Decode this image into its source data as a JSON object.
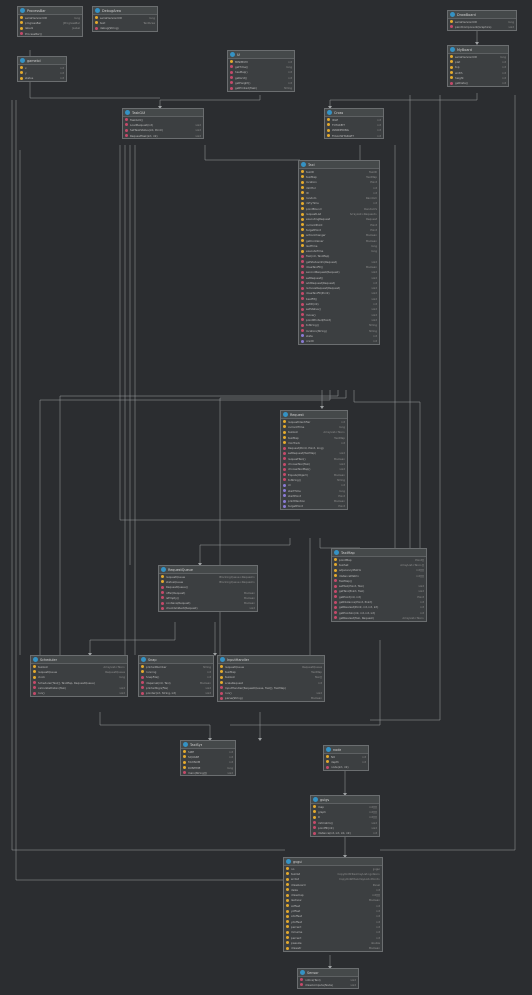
{
  "classes": [
    {
      "id": "processbar",
      "name": "ProcessBar",
      "members": [
        [
          "f",
          "serialVersionUID",
          "long"
        ],
        [
          "f",
          "progressBar",
          "JProgressBar"
        ],
        [
          "f",
          "label1",
          "JLabel"
        ],
        [
          "m",
          "ProcessBar()",
          ""
        ]
      ]
    },
    {
      "id": "debugarea",
      "name": "DebugArea",
      "members": [
        [
          "f",
          "serialVersionUID",
          "long"
        ],
        [
          "f",
          "text",
          "TextArea"
        ],
        [
          "m",
          "debug(String)",
          ""
        ]
      ]
    },
    {
      "id": "drawboard",
      "name": "DrawBoard",
      "members": [
        [
          "f",
          "serialVersionUID",
          "long"
        ],
        [
          "m",
          "paintComponent(Graphics)",
          "void"
        ]
      ]
    },
    {
      "id": "gamelol",
      "name": "gamelol",
      "members": [
        [
          "f",
          "x",
          "int"
        ],
        [
          "f",
          "y",
          "int"
        ],
        [
          "f",
          "status",
          "int"
        ]
      ]
    },
    {
      "id": "ui",
      "name": "UI",
      "members": [
        [
          "f",
          "MINIMUM",
          "int"
        ],
        [
          "m",
          "getTime()",
          "long"
        ],
        [
          "m",
          "hasMap()",
          "int"
        ],
        [
          "m",
          "getGrid()",
          "int"
        ],
        [
          "m",
          "getHeight()",
          "int"
        ],
        [
          "m",
          "getPrinted(Task)",
          "String"
        ]
      ]
    },
    {
      "id": "myboard",
      "name": "MyBoard",
      "members": [
        [
          "f",
          "serialVersionUID",
          "long"
        ],
        [
          "f",
          "plat",
          "int"
        ],
        [
          "f",
          "top",
          "int"
        ],
        [
          "f",
          "width",
          "int"
        ],
        [
          "f",
          "height",
          "int"
        ],
        [
          "m",
          "getData()",
          "int"
        ]
      ]
    },
    {
      "id": "taskgui",
      "name": "TaskGUI",
      "members": [
        [
          "m",
          "TaskGUI()",
          ""
        ],
        [
          "m",
          "LoadRequest(int)",
          "void"
        ],
        [
          "m",
          "SetTaskStatus(int, Point)",
          "void"
        ],
        [
          "m",
          "RequestTask(int, int)",
          "void"
        ]
      ]
    },
    {
      "id": "cross",
      "name": "Cross",
      "members": [
        [
          "f",
          "IDLE",
          "int"
        ],
        [
          "f",
          "TOTAKEIT",
          "int"
        ],
        [
          "f",
          "WANDERING",
          "int"
        ],
        [
          "f",
          "FOLLOWTARGET",
          "int"
        ]
      ]
    },
    {
      "id": "taxi",
      "name": "Taxi",
      "members": [
        [
          "f",
          "taxiID",
          "TaxiID"
        ],
        [
          "f",
          "taxiMap",
          "TaxiMap"
        ],
        [
          "f",
          "location",
          "Point"
        ],
        [
          "f",
          "dimHor",
          "int"
        ],
        [
          "f",
          "ID",
          "int"
        ],
        [
          "f",
          "random",
          "Random"
        ],
        [
          "f",
          "dirtyTime",
          "int"
        ],
        [
          "f",
          "pointBound",
          "RandomS"
        ],
        [
          "f",
          "requestList",
          "ArrayList<Request>"
        ],
        [
          "f",
          "executingRequest",
          "Request"
        ],
        [
          "f",
          "currentPoint",
          "Point"
        ],
        [
          "f",
          "targetPoint",
          "Point"
        ],
        [
          "f",
          "actionChanger",
          "Boolean"
        ],
        [
          "f",
          "getContainer",
          "Boolean"
        ],
        [
          "f",
          "lastTime",
          "long"
        ],
        [
          "f",
          "executeTime",
          "long"
        ],
        [
          "m",
          "Taxi(int, TaxiMap)",
          ""
        ],
        [
          "m",
          "getStatusinfo(Request)",
          "void"
        ],
        [
          "m",
          "doseTaxiFit()",
          "Boolean"
        ],
        [
          "m",
          "secondRequest(Request)",
          "void"
        ],
        [
          "m",
          "setRequest()",
          "void"
        ],
        [
          "m",
          "addRequest(Request)",
          "int"
        ],
        [
          "m",
          "removeRequest(Request)",
          "void"
        ],
        [
          "m",
          "doseTaxiFit(Point)",
          "void"
        ],
        [
          "m",
          "bestFit()",
          "void"
        ],
        [
          "m",
          "setID(int)",
          "int"
        ],
        [
          "m",
          "setStatus()",
          "void"
        ],
        [
          "m",
          "move()",
          "void"
        ],
        [
          "m",
          "pointPrinted(Point)",
          "void"
        ],
        [
          "m",
          "toString()",
          "String"
        ],
        [
          "m",
          "location(String)",
          "String"
        ],
        [
          "p",
          "state",
          "int"
        ],
        [
          "p",
          "credit",
          "int"
        ]
      ]
    },
    {
      "id": "request",
      "name": "Request",
      "members": [
        [
          "f",
          "requestIdentifier",
          "int"
        ],
        [
          "f",
          "currentTime",
          "long"
        ],
        [
          "f",
          "taxiList",
          "ArrayList<Taxi>"
        ],
        [
          "f",
          "taxiMap",
          "TaxiMap"
        ],
        [
          "f",
          "minTrack",
          "int"
        ],
        [
          "m",
          "Request(Point, Point, long)",
          ""
        ],
        [
          "m",
          "setRequest(TaxiMap)",
          "void"
        ],
        [
          "m",
          "requestTaxi()",
          "Boolean"
        ],
        [
          "m",
          "chooseTaxi(Taxi)",
          "void"
        ],
        [
          "m",
          "chooseTaxiMap()",
          "void"
        ],
        [
          "m",
          "Equals(Object)",
          "Boolean"
        ],
        [
          "m",
          "toString()",
          "String"
        ],
        [
          "p",
          "id",
          "int"
        ],
        [
          "p",
          "startTime",
          "long"
        ],
        [
          "p",
          "startPoint",
          "Point"
        ],
        [
          "p",
          "printMention",
          "Boolean"
        ],
        [
          "p",
          "targetPoint",
          "Point"
        ]
      ]
    },
    {
      "id": "requestqueue",
      "name": "RequestQueue",
      "members": [
        [
          "f",
          "requestQueue",
          "BlockingQueue<Request>"
        ],
        [
          "f",
          "statusQueue",
          "BlockingQueue<Request>"
        ],
        [
          "m",
          "RequestQueue()",
          ""
        ],
        [
          "m",
          "offer(Request)",
          "Boolean"
        ],
        [
          "m",
          "isEmpty()",
          "Boolean"
        ],
        [
          "m",
          "contains(Request)",
          "Boolean"
        ],
        [
          "m",
          "checkIsInRect(Request)",
          "void"
        ]
      ]
    },
    {
      "id": "taximap",
      "name": "TaxiMap",
      "members": [
        [
          "f",
          "pointMap",
          "Point[]"
        ],
        [
          "f",
          "taxiSet",
          "ArrayList<Taxi>[]"
        ],
        [
          "f",
          "adjacencyMatrix",
          "int[][]"
        ],
        [
          "f",
          "distanceMatrix",
          "int[][]"
        ],
        [
          "m",
          "TaxiMap()",
          ""
        ],
        [
          "m",
          "setTaxi(Point, Taxi)",
          "void"
        ],
        [
          "m",
          "getTaxi(Point, Taxi)",
          "void"
        ],
        [
          "m",
          "getPoint(int, int)",
          "Point"
        ],
        [
          "m",
          "getDistance(Point, Point)",
          "int"
        ],
        [
          "m",
          "getNearest(Point, int, int, int)",
          "int"
        ],
        [
          "m",
          "getPointsIn(int, int, int, int)",
          "int"
        ],
        [
          "m",
          "getNearest(Taxi, Request)",
          "ArrayList<Taxi>"
        ]
      ]
    },
    {
      "id": "scheduler",
      "name": "Scheduler",
      "members": [
        [
          "f",
          "taxiList",
          "ArrayList<Taxi>"
        ],
        [
          "f",
          "requestQueue",
          "RequestQueue"
        ],
        [
          "f",
          "clock",
          "long"
        ],
        [
          "m",
          "Scheduler(Taxi[], TaxiMap, RequestQueue)",
          ""
        ],
        [
          "m",
          "calculateDistan(Taxi)",
          "void"
        ],
        [
          "m",
          "run()",
          "void"
        ]
      ]
    },
    {
      "id": "snap",
      "name": "Snap",
      "members": [
        [
          "f",
          "printedNumber",
          "String"
        ],
        [
          "f",
          "running",
          "int"
        ],
        [
          "m",
          "SnapFile()",
          "int"
        ],
        [
          "m",
          "dispersal(int, Taxi)",
          "Boolean"
        ],
        [
          "m",
          "printedSign(File)",
          "void"
        ],
        [
          "m",
          "pointer(int, String, int)",
          "void"
        ]
      ]
    },
    {
      "id": "inputhandler",
      "name": "InputHandler",
      "members": [
        [
          "f",
          "requestQueue",
          "RequestQueue"
        ],
        [
          "f",
          "taxiMap",
          "TaxiMap"
        ],
        [
          "f",
          "taxiList",
          "Taxi[]"
        ],
        [
          "f",
          "scaleRequest",
          "int"
        ],
        [
          "m",
          "InputHandler(RequestQueue, Taxi[], TaxiMap)",
          ""
        ],
        [
          "m",
          "run()",
          "void"
        ],
        [
          "m",
          "parse(String)",
          "Boolean"
        ]
      ]
    },
    {
      "id": "taxisys",
      "name": "TaxiSys",
      "members": [
        [
          "f",
          "SIZE",
          "int"
        ],
        [
          "f",
          "SQUARE",
          "int"
        ],
        [
          "f",
          "TAXINUM",
          "int"
        ],
        [
          "f",
          "RUNTIME",
          "long"
        ],
        [
          "m",
          "main(String[])",
          "void"
        ]
      ]
    },
    {
      "id": "node",
      "name": "node",
      "members": [
        [
          "f",
          "NO",
          "int"
        ],
        [
          "f",
          "depth",
          "int"
        ],
        [
          "m",
          "node(int, int)",
          ""
        ]
      ]
    },
    {
      "id": "guigv",
      "name": "guigv",
      "members": [
        [
          "f",
          "map",
          "int[][]"
        ],
        [
          "f",
          "graph",
          "int[][]"
        ],
        [
          "f",
          "D",
          "int[][]"
        ],
        [
          "m",
          "initmatrix()",
          "void"
        ],
        [
          "m",
          "pointfill(int)",
          "void"
        ],
        [
          "m",
          "distance(int, int, int, int)",
          "int"
        ]
      ]
    },
    {
      "id": "gvgui",
      "name": "gvgui",
      "members": [
        [
          "f",
          "no",
          "gvgui"
        ],
        [
          "f",
          "taxilist",
          "CopyOnWriteArrayList<gvtaxi>"
        ],
        [
          "f",
          "srclist",
          "CopyOnWriteArrayList<Point>"
        ],
        [
          "f",
          "drawboard",
          "Panel"
        ],
        [
          "f",
          "dsize",
          "int"
        ],
        [
          "f",
          "drawmap",
          "int[][]"
        ],
        [
          "f",
          "lastnow",
          "Boolean"
        ],
        [
          "f",
          "xoffset",
          "int"
        ],
        [
          "f",
          "yoffset",
          "int"
        ],
        [
          "f",
          "xdoffset",
          "int"
        ],
        [
          "f",
          "ydoffset",
          "int"
        ],
        [
          "f",
          "percent",
          "int"
        ],
        [
          "f",
          "mrname",
          "int"
        ],
        [
          "f",
          "percent",
          "int"
        ],
        [
          "f",
          "pwssize",
          "double"
        ],
        [
          "f",
          "drawstr",
          "Boolean"
        ]
      ]
    },
    {
      "id": "sensor",
      "name": "Sensor",
      "members": [
        [
          "m",
          "notice(Taxi)",
          "void"
        ],
        [
          "m",
          "drawCompute(Node)",
          "void"
        ]
      ]
    }
  ],
  "labels": {
    "creates": "«creates»",
    "watermark": ""
  },
  "colors": {
    "bg": "#2b2d30",
    "box": "#3c3f41",
    "header": "#45494a",
    "line": "#9da0a2",
    "field": "#e3a92e",
    "method": "#c44a6a",
    "property": "#8a7bd4",
    "icon": "#3592c4"
  }
}
